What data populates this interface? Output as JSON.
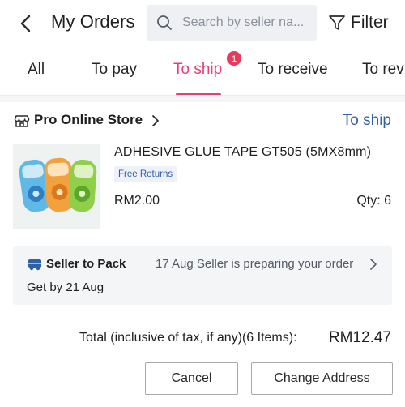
{
  "header": {
    "back_icon": "chevron-left-icon",
    "title": "My Orders",
    "search": {
      "icon": "search-icon",
      "value": "",
      "placeholder": "Search by seller na..."
    },
    "filter": {
      "icon": "filter-icon",
      "label": "Filter"
    }
  },
  "tabs": {
    "items": [
      {
        "label": "All",
        "active": false
      },
      {
        "label": "To pay",
        "active": false
      },
      {
        "label": "To ship",
        "active": true,
        "badge": "1"
      },
      {
        "label": "To receive",
        "active": false
      },
      {
        "label": "To rev",
        "active": false
      }
    ],
    "accent_color": "#e0417a",
    "badge_color": "#e83a5a"
  },
  "order": {
    "store": {
      "icon": "store-icon",
      "name": "Pro Online Store",
      "chevron_icon": "chevron-right-icon"
    },
    "status": "To ship",
    "status_color": "#2f5fa8",
    "product": {
      "thumbnail": "glue-tape-product-image",
      "title": "ADHESIVE GLUE TAPE GT505 (5MX8mm)",
      "tag": "Free Returns",
      "price": "RM2.00",
      "quantity": "Qty: 6"
    },
    "shipping": {
      "icon": "delivery-truck-icon",
      "status": "Seller to Pack",
      "message": "17 Aug Seller is preparing your order",
      "eta": "Get by 21 Aug",
      "chevron_icon": "chevron-right-icon"
    },
    "total": {
      "label": "Total (inclusive of tax, if any)(6 Items):",
      "amount": "RM12.47"
    },
    "actions": {
      "cancel_label": "Cancel",
      "change_address_label": "Change Address"
    }
  }
}
